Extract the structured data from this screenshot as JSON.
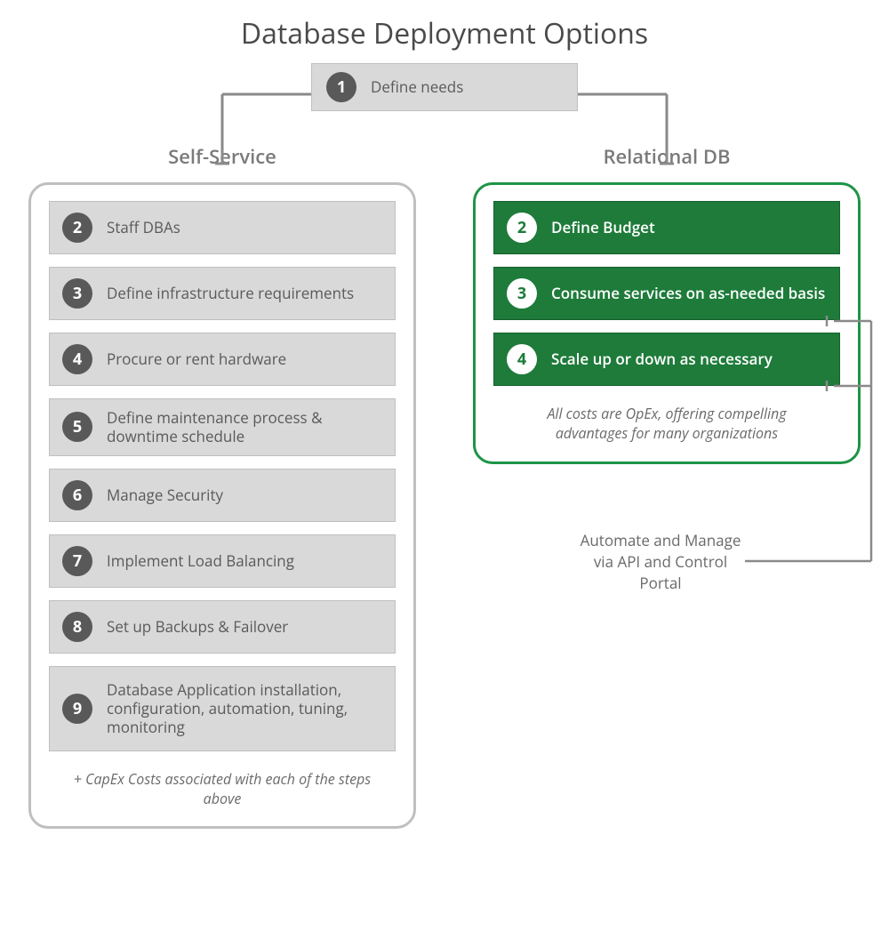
{
  "title": "Database Deployment Options",
  "top_step": {
    "num": "1",
    "label": "Define needs"
  },
  "left": {
    "heading": "Self-Service",
    "steps": [
      {
        "num": "2",
        "label": "Staff DBAs"
      },
      {
        "num": "3",
        "label": "Define infrastructure requirements"
      },
      {
        "num": "4",
        "label": "Procure or rent hardware"
      },
      {
        "num": "5",
        "label": "Define maintenance process & downtime schedule"
      },
      {
        "num": "6",
        "label": "Manage Security"
      },
      {
        "num": "7",
        "label": "Implement Load Balancing"
      },
      {
        "num": "8",
        "label": "Set up Backups & Failover"
      },
      {
        "num": "9",
        "label": "Database Application installation, configuration, automation, tuning, monitoring"
      }
    ],
    "note": "+ CapEx Costs associated with each of the steps above"
  },
  "right": {
    "heading": "Relational DB",
    "steps": [
      {
        "num": "2",
        "label": "Define Budget"
      },
      {
        "num": "3",
        "label": "Consume services on as-needed basis"
      },
      {
        "num": "4",
        "label": "Scale up or down as necessary"
      }
    ],
    "note": "All costs are OpEx, offering compelling advantages for many organizations"
  },
  "automate": "Automate and Manage via API and Control Portal",
  "colors": {
    "gray_box": "#d9d9d9",
    "gray_border": "#bfbfbf",
    "dark_gray": "#595959",
    "green_box": "#1e7b3a",
    "green_border": "#1e9447"
  }
}
